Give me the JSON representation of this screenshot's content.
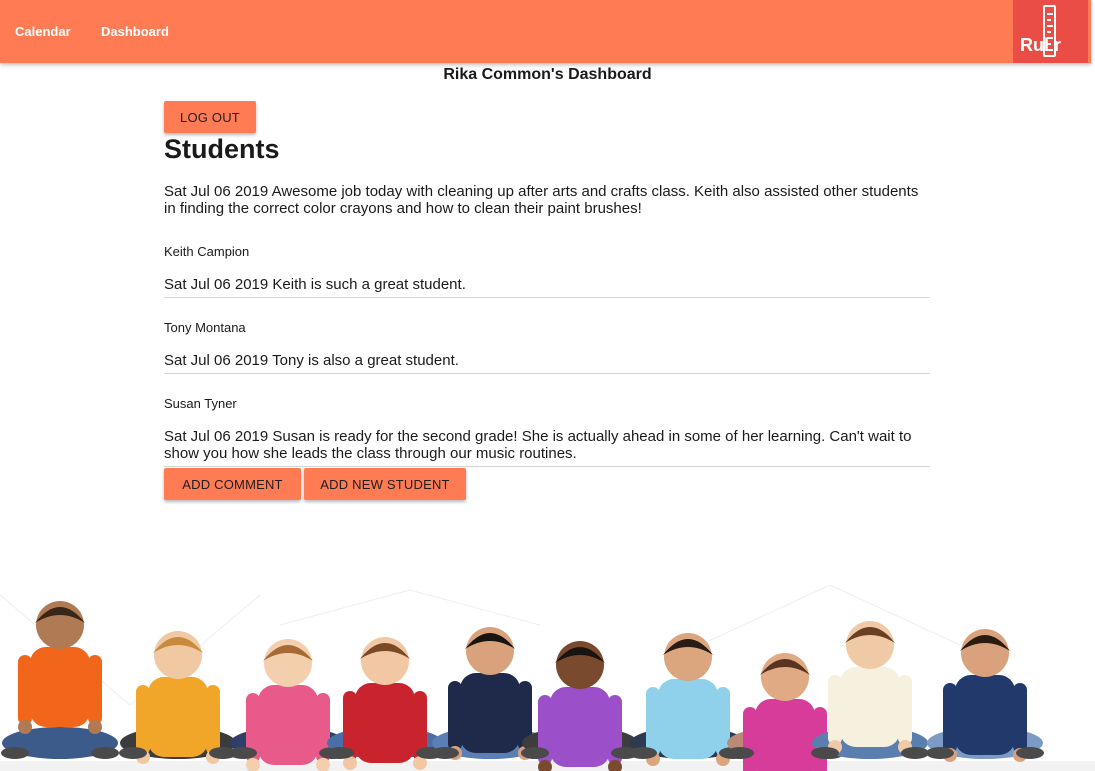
{
  "nav": {
    "links": [
      "Calendar",
      "Dashboard"
    ],
    "logo_text": "Rul  r"
  },
  "dashboard": {
    "title": "Rika Common's Dashboard",
    "logout_label": "LOG OUT",
    "students_heading": "Students",
    "general_comment": "Sat Jul 06 2019 Awesome job today with cleaning up after arts and crafts class. Keith also assisted other students in finding the correct color crayons and how to clean their paint brushes!",
    "students": [
      {
        "name": "Keith Campion",
        "comment": "Sat Jul 06 2019 Keith is such a great student."
      },
      {
        "name": "Tony Montana",
        "comment": "Sat Jul 06 2019 Tony is also a great student."
      },
      {
        "name": "Susan Tyner",
        "comment": "Sat Jul 06 2019 Susan is ready for the second grade! She is actually ahead in some of her learning. Can't wait to show you how she leads the class through our music routines."
      }
    ],
    "add_comment_label": "ADD COMMENT",
    "add_student_label": "ADD NEW STUDENT"
  },
  "colors": {
    "navbar": "#ff7b54",
    "logo_bg": "#e94d45",
    "button": "#ff7b54"
  }
}
